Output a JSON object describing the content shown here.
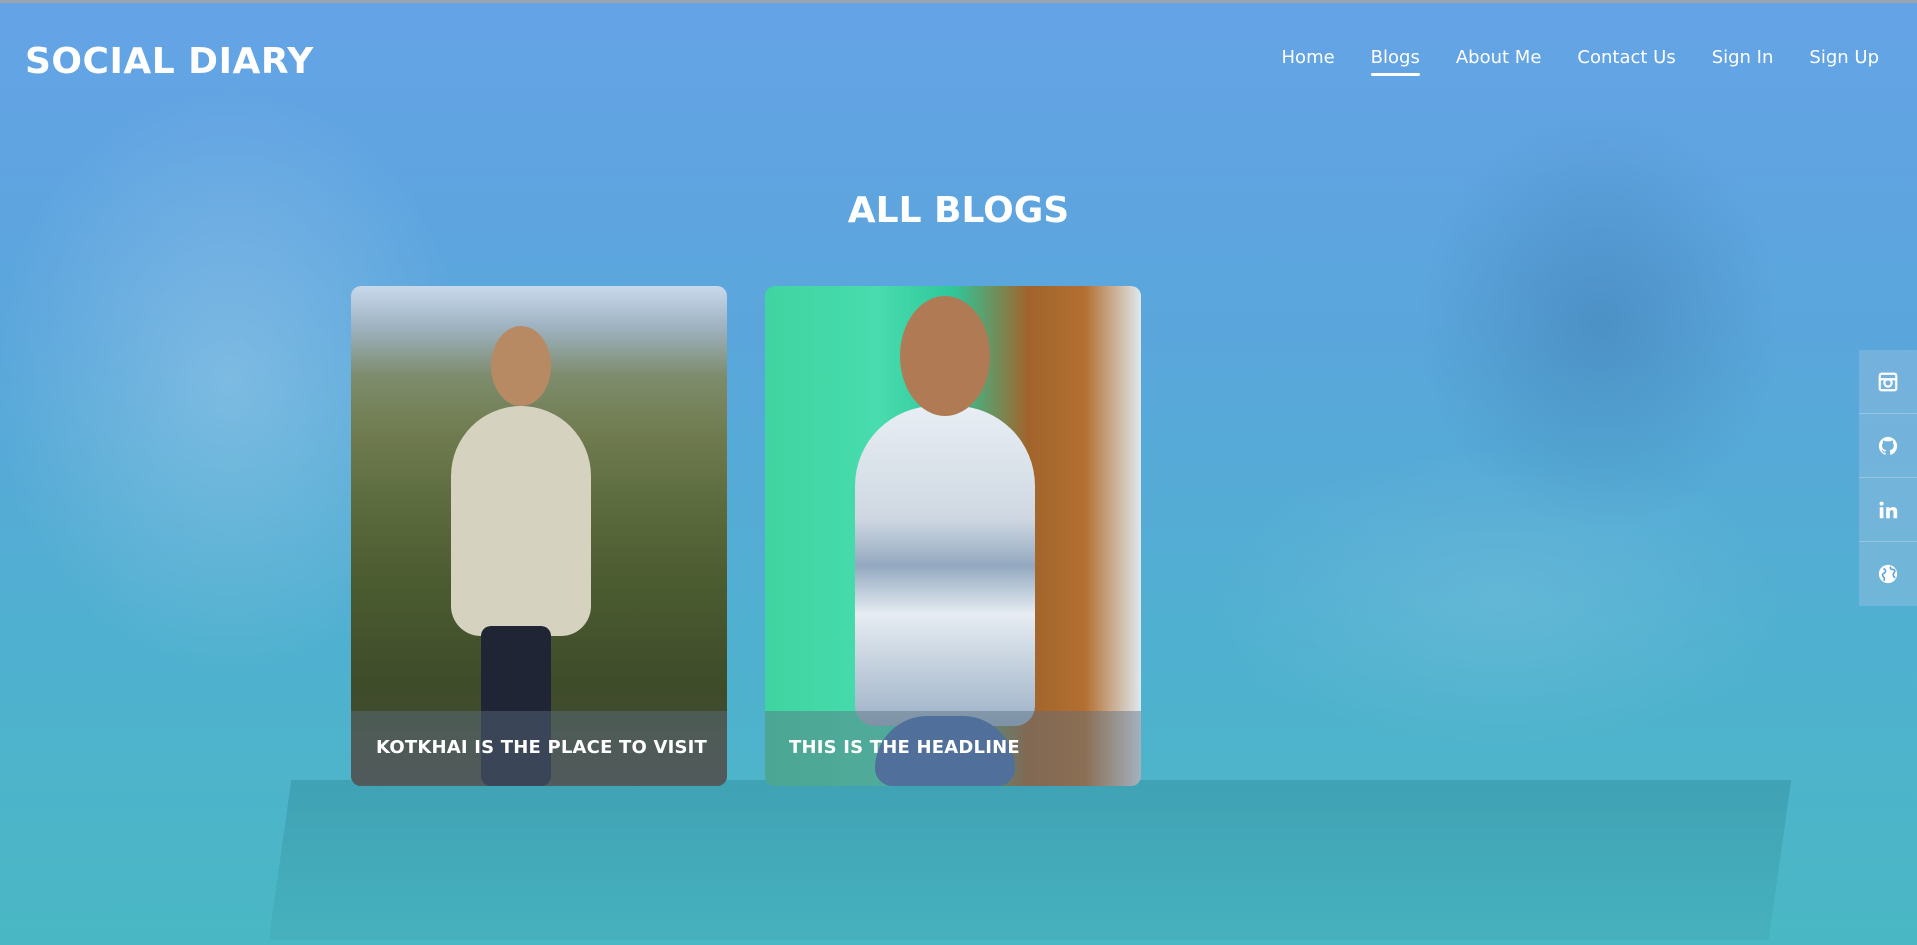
{
  "brand": {
    "name": "SOCIAL DIARY"
  },
  "nav": {
    "items": [
      {
        "label": "Home",
        "active": false
      },
      {
        "label": "Blogs",
        "active": true
      },
      {
        "label": "About Me",
        "active": false
      },
      {
        "label": "Contact Us",
        "active": false
      },
      {
        "label": "Sign In",
        "active": false
      },
      {
        "label": "Sign Up",
        "active": false
      }
    ]
  },
  "main": {
    "title": "ALL BLOGS",
    "blogs": [
      {
        "title": "KOTKHAI IS THE PLACE TO VISIT"
      },
      {
        "title": "THIS IS THE HEADLINE"
      }
    ]
  },
  "social": {
    "icons": [
      "instagram-icon",
      "github-icon",
      "linkedin-icon",
      "globe-icon"
    ]
  },
  "colors": {
    "overlay_top": "#65a3e6",
    "overlay_bottom": "#4ab8c4",
    "text": "#ffffff"
  }
}
